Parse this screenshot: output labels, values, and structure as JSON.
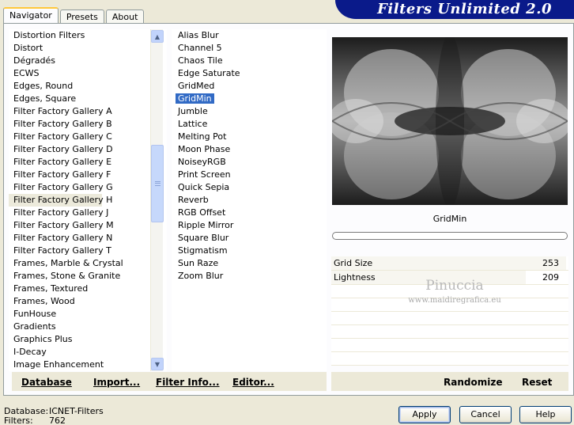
{
  "header": {
    "title": "Filters Unlimited 2.0"
  },
  "tabs": [
    {
      "label": "Navigator",
      "active": true
    },
    {
      "label": "Presets",
      "active": false
    },
    {
      "label": "About",
      "active": false
    }
  ],
  "categories": [
    "Distortion Filters",
    "Distort",
    "Dégradés",
    "ECWS",
    "Edges, Round",
    "Edges, Square",
    "Filter Factory Gallery A",
    "Filter Factory Gallery B",
    "Filter Factory Gallery C",
    "Filter Factory Gallery D",
    "Filter Factory Gallery E",
    "Filter Factory Gallery F",
    "Filter Factory Gallery G",
    "Filter Factory Gallery H",
    "Filter Factory Gallery J",
    "Filter Factory Gallery M",
    "Filter Factory Gallery N",
    "Filter Factory Gallery T",
    "Frames, Marble & Crystal",
    "Frames, Stone & Granite",
    "Frames, Textured",
    "Frames, Wood",
    "FunHouse",
    "Gradients",
    "Graphics Plus",
    "I-Decay",
    "Image Enhancement"
  ],
  "selected_category": "Filter Factory Gallery H",
  "filters": [
    "Alias Blur",
    "Channel 5",
    "Chaos Tile",
    "Edge Saturate",
    "GridMed",
    "GridMin",
    "Jumble",
    "Lattice",
    "Melting Pot",
    "Moon Phase",
    "NoiseyRGB",
    "Print Screen",
    "Quick Sepia",
    "Reverb",
    "RGB Offset",
    "Ripple Mirror",
    "Square Blur",
    "Stigmatism",
    "Sun Raze",
    "Zoom Blur"
  ],
  "selected_filter": "GridMin",
  "preview": {
    "filter_name": "GridMin"
  },
  "sliders": [
    {
      "label": "Grid Size",
      "value": "253",
      "level": 0.99
    },
    {
      "label": "Lightness",
      "value": "209",
      "level": 0.82
    }
  ],
  "watermark": {
    "name": "Pinuccia",
    "url": "www.maidiregrafica.eu"
  },
  "toolbar": {
    "database": "Database",
    "import": "Import...",
    "filter_info": "Filter Info...",
    "editor": "Editor...",
    "randomize": "Randomize",
    "reset": "Reset"
  },
  "status": {
    "database_label": "Database:",
    "database_value": "ICNET-Filters",
    "filters_label": "Filters:",
    "filters_value": "762"
  },
  "buttons": {
    "apply": "Apply",
    "cancel": "Cancel",
    "help": "Help"
  },
  "icons": {
    "scroll_up": "chevron-up-icon",
    "scroll_down": "chevron-down-icon"
  },
  "colors": {
    "banner": "#0a1a8a",
    "selection": "#316ac5",
    "tab_highlight": "#ffc83c"
  }
}
